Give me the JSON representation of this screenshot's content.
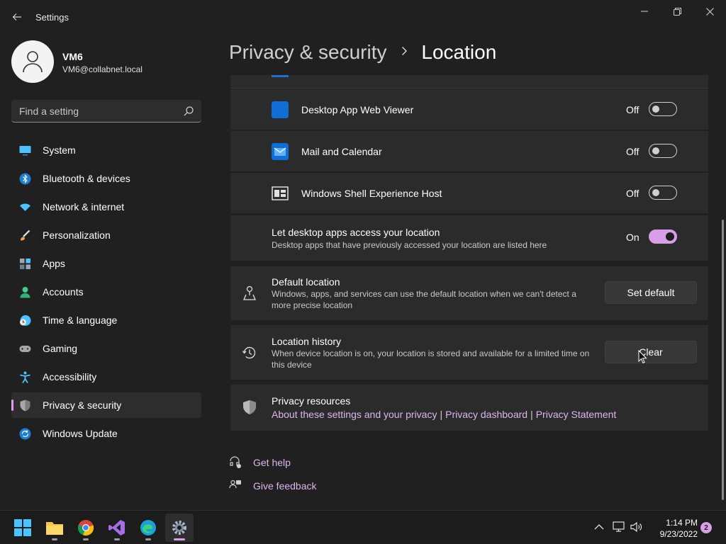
{
  "window": {
    "title": "Settings"
  },
  "profile": {
    "name": "VM6",
    "email": "VM6@collabnet.local"
  },
  "search": {
    "placeholder": "Find a setting"
  },
  "sidebar": {
    "items": [
      {
        "label": "System",
        "icon": "system-icon",
        "active": false
      },
      {
        "label": "Bluetooth & devices",
        "icon": "bluetooth-icon",
        "active": false
      },
      {
        "label": "Network & internet",
        "icon": "wifi-icon",
        "active": false
      },
      {
        "label": "Personalization",
        "icon": "brush-icon",
        "active": false
      },
      {
        "label": "Apps",
        "icon": "apps-icon",
        "active": false
      },
      {
        "label": "Accounts",
        "icon": "person-icon",
        "active": false
      },
      {
        "label": "Time & language",
        "icon": "clock-globe-icon",
        "active": false
      },
      {
        "label": "Gaming",
        "icon": "gamepad-icon",
        "active": false
      },
      {
        "label": "Accessibility",
        "icon": "accessibility-icon",
        "active": false
      },
      {
        "label": "Privacy & security",
        "icon": "shield-icon",
        "active": true
      },
      {
        "label": "Windows Update",
        "icon": "update-icon",
        "active": false
      }
    ]
  },
  "breadcrumb": {
    "parent": "Privacy & security",
    "current": "Location"
  },
  "apps": [
    {
      "name": "Desktop App Web Viewer",
      "state": "Off",
      "on": false,
      "icon": "web-viewer-icon"
    },
    {
      "name": "Mail and Calendar",
      "state": "Off",
      "on": false,
      "icon": "mail-icon"
    },
    {
      "name": "Windows Shell Experience Host",
      "state": "Off",
      "on": false,
      "icon": "shell-host-icon"
    }
  ],
  "desktop_apps": {
    "title": "Let desktop apps access your location",
    "description": "Desktop apps that have previously accessed your location are listed here",
    "state": "On",
    "on": true
  },
  "default_location": {
    "title": "Default location",
    "description": "Windows, apps, and services can use the default location when we can't detect a more precise location",
    "button": "Set default"
  },
  "location_history": {
    "title": "Location history",
    "description": "When device location is on, your location is stored and available for a limited time on this device",
    "button": "Clear"
  },
  "privacy_resources": {
    "title": "Privacy resources",
    "links": [
      "About these settings and your privacy",
      "Privacy dashboard",
      "Privacy Statement"
    ]
  },
  "help": {
    "get_help": "Get help",
    "give_feedback": "Give feedback"
  },
  "taskbar": {
    "apps": [
      "start-icon",
      "file-explorer-icon",
      "chrome-icon",
      "visual-studio-icon",
      "edge-icon",
      "settings-icon"
    ],
    "time": "1:14 PM",
    "date": "9/23/2022",
    "notification_count": "2"
  },
  "colors": {
    "accent": "#d89fe8",
    "background": "#202020",
    "card": "#2b2b2b"
  }
}
